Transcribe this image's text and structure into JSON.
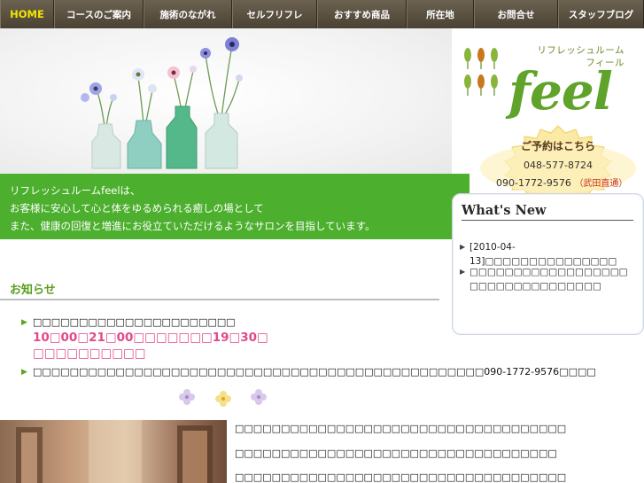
{
  "nav": {
    "items": [
      "HOME",
      "コースのご案内",
      "施術のながれ",
      "セルフリフレ",
      "おすすめ商品",
      "所在地",
      "お問合せ",
      "スタッフブログ"
    ]
  },
  "logo": {
    "small_line1": "リフレッシュルーム",
    "small_line2": "フィール",
    "big": "feel"
  },
  "reservation": {
    "title": "ご予約はこちら",
    "phone1": "048-577-8724",
    "phone2": "090-1772-9576",
    "name": "（武田直通）"
  },
  "intro": {
    "line1": "リフレッシュルームfeelは、",
    "line2": "お客様に安心して心と体をゆるめられる癒しの場として",
    "line3": "また、健康の回復と増進にお役立ていただけるようなサロンを目指しています。"
  },
  "whatsnew": {
    "title": "What's New",
    "item1": "[2010-04-13]□□□□□□□□□□□□□□□",
    "item2": "□□□□□□□□□□□□□□□□□□□□□□□□□□□□□□□□□"
  },
  "notice": {
    "title": "お知らせ",
    "item1": "□□□□□□□□□□□□□□□□□□□□□□",
    "item1_hours": "10□00□21□00□□□□□□□19□30□",
    "item1_hours2": "□□□□□□□□□□",
    "item2": "□□□□□□□□□□□□□□□□□□□□□□□□□□□□□□□□□□□□□□□□□□□□□□□□□090-1772-9576□□□□"
  },
  "bottom": {
    "line1": "□□□□□□□□□□□□□□□□□□□□□□□□□□□□□□□□□□□□",
    "line2": "□□□□□□□□□□□□□□□□□□□□□□□□□□□□□□□□□□□",
    "line3": "□□□□□□□□□□□□□□□□□□□□□□□□□□□□□□□□□□□□"
  },
  "colors": {
    "nav_bg": "#4a4233",
    "nav_active": "#f2e600",
    "band_green": "#4caf2e",
    "logo_green": "#5fa32a",
    "pink": "#e04a8a"
  }
}
